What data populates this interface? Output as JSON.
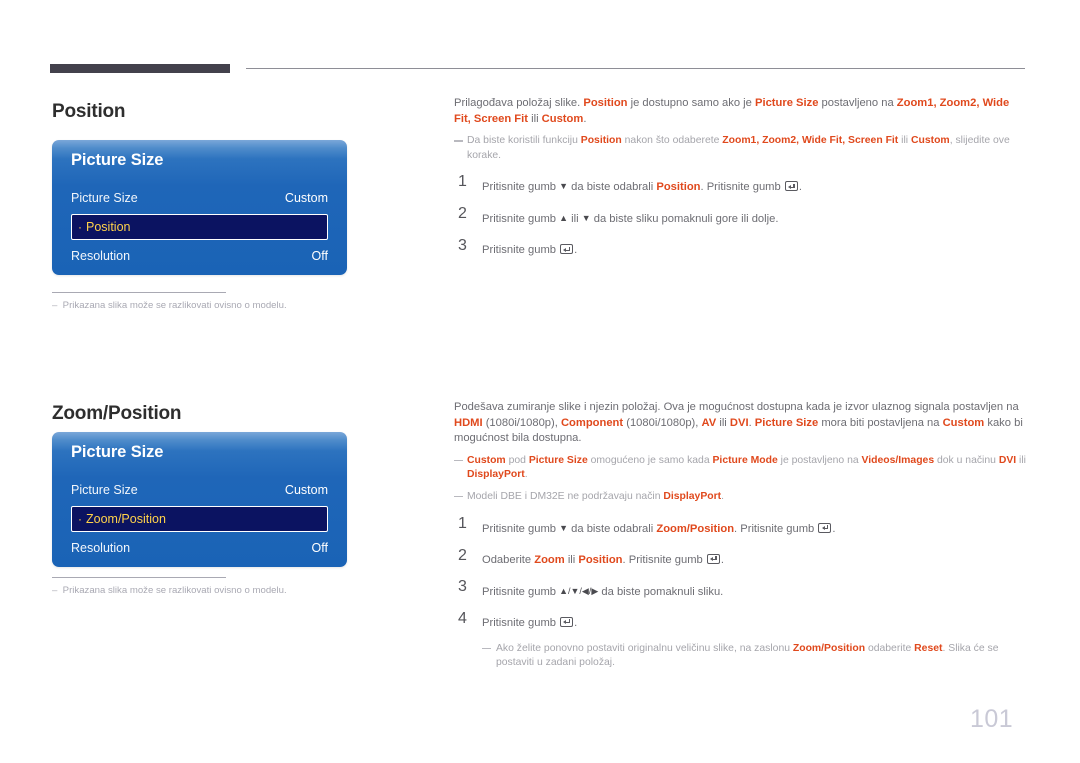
{
  "page": {
    "number": "101",
    "accent_orange": "#e0491d",
    "osd_blue": "#1a63b6",
    "osd_selected_navy": "#0b1361",
    "osd_selected_text": "#ffd24a",
    "header_bar_color": "#43414c"
  },
  "sections": [
    {
      "title": "Position",
      "osd": {
        "heading": "Picture Size",
        "rows": [
          {
            "label": "Picture Size",
            "value": "Custom"
          }
        ],
        "selected_row": {
          "bullet": "·",
          "label": "Position"
        },
        "rows_after": [
          {
            "label": "Resolution",
            "value": "Off"
          }
        ]
      },
      "note": "Prikazana slika može se razlikovati ovisno o modelu.",
      "intro": {
        "lead": "Prilagođava položaj slike.",
        "term1": "Position",
        "mid1": "je dostupno samo ako je",
        "term2": "Picture Size",
        "mid2": "postavljeno na",
        "terms3": "Zoom1, Zoom2, Wide Fit, Screen Fit",
        "mid3": "ili",
        "term4": "Custom",
        "end": "."
      },
      "intro_note": {
        "a": "Da biste koristili funkciju",
        "b": "Position",
        "c": "nakon što odaberete",
        "d": "Zoom1, Zoom2, Wide Fit, Screen Fit",
        "e": "ili",
        "f": "Custom",
        "g": ", slijedite ove korake."
      },
      "steps": [
        {
          "num": "1",
          "a": "Pritisnite gumb",
          "arrow": "▼",
          "b": "da biste odabrali",
          "term": "Position",
          "c": ". Pritisnite gumb",
          "d": "."
        },
        {
          "num": "2",
          "a": "Pritisnite gumb",
          "arrow": "▲",
          "b": "ili",
          "arrow2": "▼",
          "c": "da biste sliku pomaknuli gore ili dolje."
        },
        {
          "num": "3",
          "a": "Pritisnite gumb",
          "d": "."
        }
      ]
    },
    {
      "title": "Zoom/Position",
      "osd": {
        "heading": "Picture Size",
        "rows": [
          {
            "label": "Picture Size",
            "value": "Custom"
          }
        ],
        "selected_row": {
          "bullet": "·",
          "label": "Zoom/Position"
        },
        "rows_after": [
          {
            "label": "Resolution",
            "value": "Off"
          }
        ]
      },
      "note": "Prikazana slika može se razlikovati ovisno o modelu.",
      "intro": {
        "lead": "Podešava zumiranje slike i njezin položaj. Ova je mogućnost dostupna kada je izvor ulaznog signala postavljen na",
        "t_hdmi": "HDMI",
        "res1": "(1080i/1080p),",
        "t_component": "Component",
        "res2": "(1080i/1080p),",
        "t_av": "AV",
        "ili": "ili",
        "t_dvi": "DVI",
        "dot": ".",
        "t_picsize": "Picture Size",
        "mid": "mora biti postavljena na",
        "t_custom": "Custom",
        "end": "kako bi mogućnost bila dostupna."
      },
      "notes": [
        {
          "a": "Custom",
          "b": "pod",
          "c": "Picture Size",
          "d": "omogućeno je samo kada",
          "e": "Picture Mode",
          "f": "je postavljeno na",
          "g": "Videos/Images",
          "h": "dok u načinu",
          "i": "DVI",
          "j": "ili",
          "k": "DisplayPort",
          "l": "."
        },
        {
          "a": "Modeli DBE i DM32E ne podržavaju način",
          "b": "DisplayPort",
          "c": "."
        }
      ],
      "steps": [
        {
          "num": "1",
          "a": "Pritisnite gumb",
          "arrow": "▼",
          "b": "da biste odabrali",
          "term": "Zoom/Position",
          "c": ". Pritisnite gumb",
          "d": "."
        },
        {
          "num": "2",
          "a": "Odaberite",
          "term": "Zoom",
          "b": "ili",
          "term2": "Position",
          "c": ". Pritisnite gumb",
          "d": "."
        },
        {
          "num": "3",
          "a": "Pritisnite gumb",
          "arrows": "▲/▼/◀/▶",
          "b": "da biste pomaknuli sliku."
        },
        {
          "num": "4",
          "a": "Pritisnite gumb",
          "d": "."
        }
      ],
      "final_note": {
        "a": "Ako želite ponovno postaviti originalnu veličinu slike, na zaslonu",
        "b": "Zoom/Position",
        "c": "odaberite",
        "d": "Reset",
        "e": ". Slika će se postaviti u zadani položaj."
      }
    }
  ]
}
